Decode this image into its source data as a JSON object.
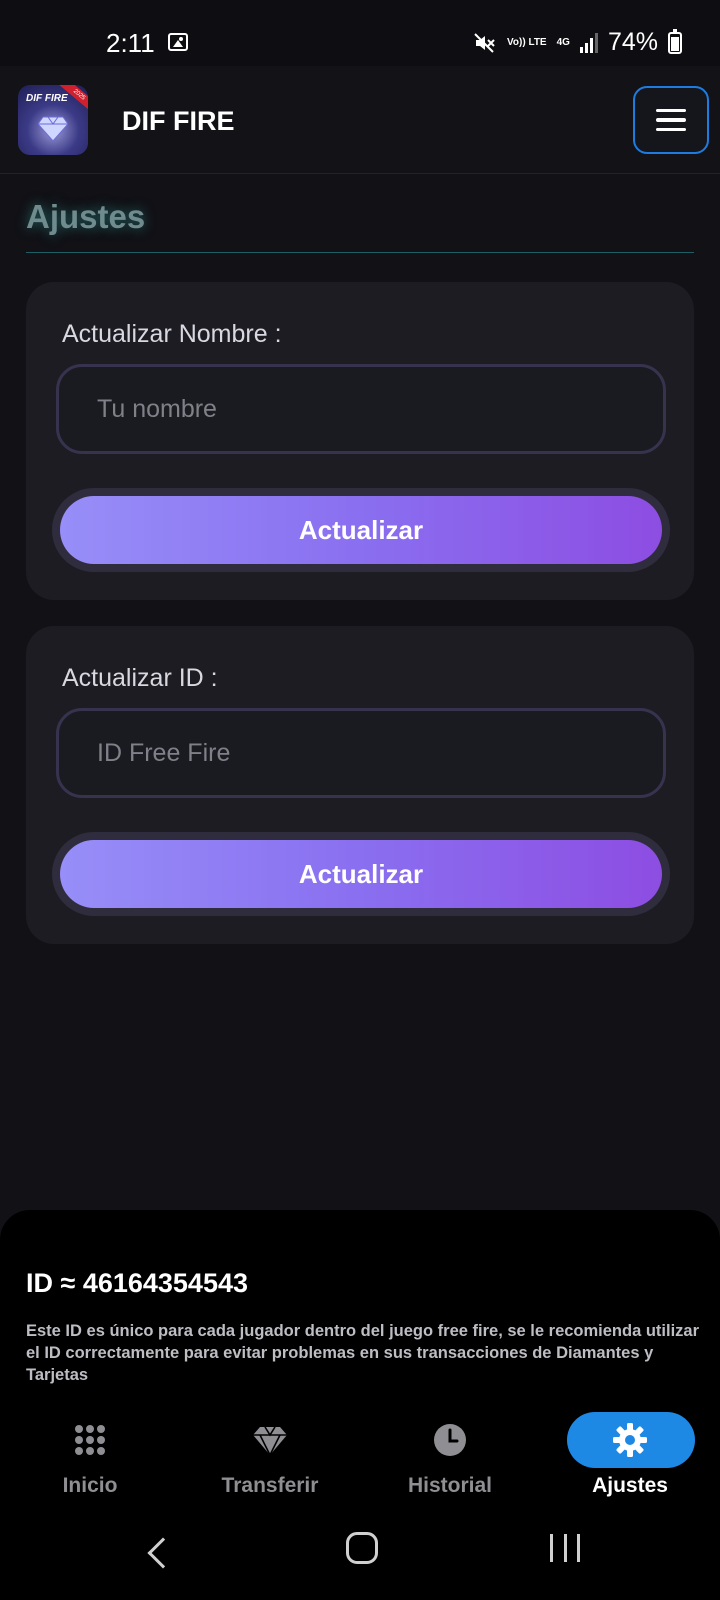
{
  "status_bar": {
    "time": "2:11",
    "network_volte": "Vo)) LTE",
    "network_type": "4G",
    "battery": "74%"
  },
  "header": {
    "app_title": "DIF FIRE",
    "logo_text": "DIF FIRE",
    "logo_badge": "2025"
  },
  "page": {
    "title": "Ajustes"
  },
  "name_card": {
    "label": "Actualizar Nombre :",
    "placeholder": "Tu nombre",
    "button_label": "Actualizar"
  },
  "id_card": {
    "label": "Actualizar ID :",
    "placeholder": "ID Free Fire",
    "button_label": "Actualizar"
  },
  "info": {
    "id_line": "ID ≈ 46164354543",
    "description": "Este ID es único para cada jugador dentro del juego free fire, se le recomienda utilizar el ID correctamente para evitar problemas en sus transacciones de Diamantes y Tarjetas"
  },
  "bottom_nav": {
    "items": [
      {
        "label": "Inicio",
        "icon": "grid-icon"
      },
      {
        "label": "Transferir",
        "icon": "diamond-icon"
      },
      {
        "label": "Historial",
        "icon": "clock-icon"
      },
      {
        "label": "Ajustes",
        "icon": "gear-icon"
      }
    ],
    "active_index": 3,
    "accent_color": "#1e88e5"
  }
}
